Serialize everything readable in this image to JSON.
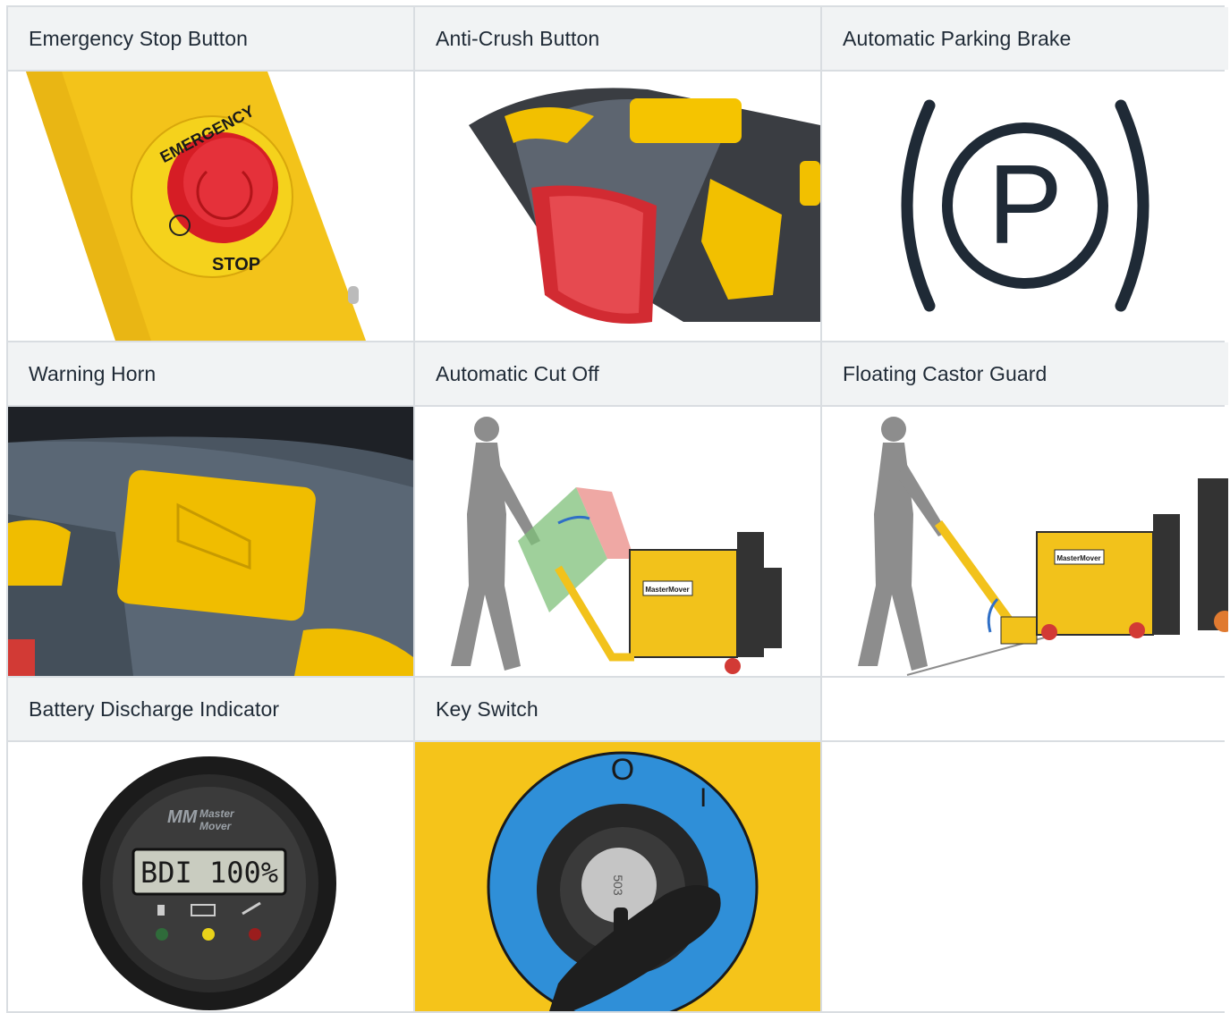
{
  "features": [
    {
      "label": "Emergency Stop Button",
      "image_text": [
        "EMERGENCY",
        "STOP"
      ]
    },
    {
      "label": "Anti-Crush Button"
    },
    {
      "label": "Automatic Parking Brake",
      "symbol": "P"
    },
    {
      "label": "Warning Horn"
    },
    {
      "label": "Automatic Cut Off",
      "badge": "MasterMover"
    },
    {
      "label": "Floating Castor Guard",
      "badge": "MasterMover"
    },
    {
      "label": "Battery Discharge Indicator",
      "brand": [
        "Master",
        "Mover"
      ],
      "display": "BDI 100%"
    },
    {
      "label": "Key Switch",
      "positions": [
        "O",
        "I"
      ],
      "key_code": "503"
    }
  ],
  "colors": {
    "header_bg": "#f1f3f4",
    "border": "#d9dde1",
    "text": "#1f2a36",
    "safety_yellow": "#f4c400",
    "stop_red": "#e3202a",
    "key_blue": "#2f8fd8"
  },
  "icons": [
    "emergency-stop-image",
    "anti-crush-image",
    "parking-brake-icon",
    "horn-image",
    "cut-off-diagram",
    "castor-guard-diagram",
    "battery-indicator-image",
    "key-switch-image"
  ]
}
